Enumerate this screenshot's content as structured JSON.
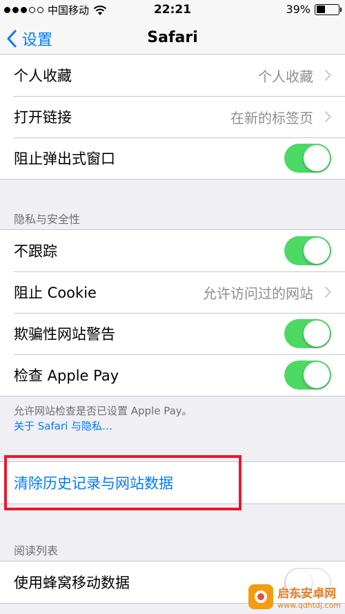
{
  "status_bar": {
    "carrier": "中国移动",
    "time": "22:21",
    "battery_percent": "39%",
    "battery_level": 0.39,
    "signal_bars_filled": 3,
    "signal_bars_total": 5
  },
  "nav": {
    "back_label": "设置",
    "title": "Safari"
  },
  "general": {
    "rows": [
      {
        "label": "个人收藏",
        "value": "个人收藏"
      },
      {
        "label": "打开链接",
        "value": "在新的标签页"
      },
      {
        "label": "阻止弹出式窗口",
        "toggle": true
      }
    ]
  },
  "privacy": {
    "header": "隐私与安全性",
    "rows": [
      {
        "label": "不跟踪",
        "toggle": true
      },
      {
        "label": "阻止 Cookie",
        "value": "允许访问过的网站"
      },
      {
        "label": "欺骗性网站警告",
        "toggle": true
      },
      {
        "label": "检查 Apple Pay",
        "toggle": true
      }
    ],
    "footer_text": "允许网站检查是否已设置 Apple Pay。",
    "footer_link": "关于 Safari 与隐私…"
  },
  "clear": {
    "label": "清除历史记录与网站数据"
  },
  "reading_list": {
    "header": "阅读列表",
    "rows": [
      {
        "label": "使用蜂窝移动数据",
        "toggle": false
      }
    ]
  },
  "watermark": {
    "title": "启东安卓网",
    "url": "www.qdhtdj.com"
  },
  "colors": {
    "accent": "#007aff",
    "toggle_on": "#4cd964",
    "highlight_box": "#e8192c"
  }
}
